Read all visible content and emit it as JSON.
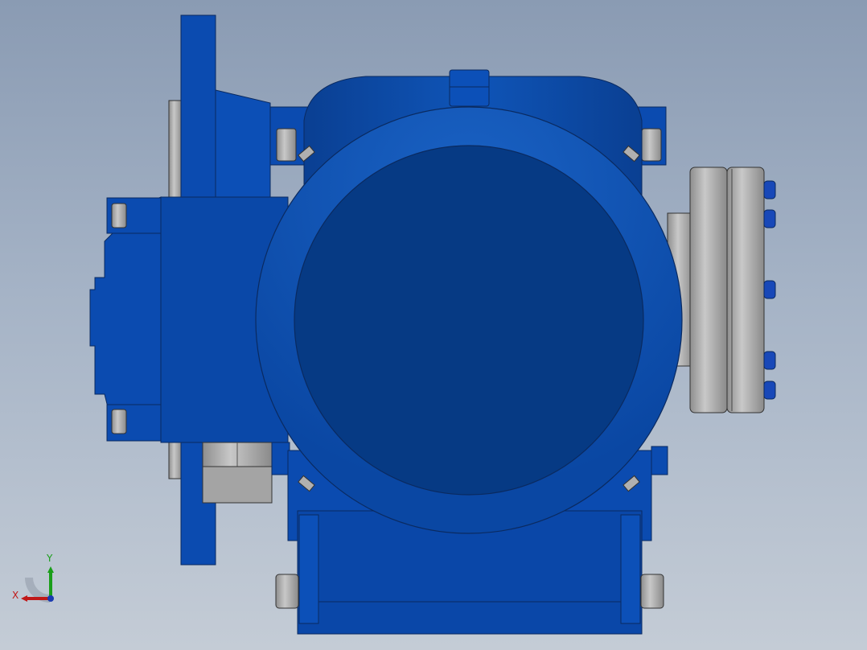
{
  "viewport": {
    "background_top": "#8a9bb3",
    "background_bottom": "#c4ccd6"
  },
  "model": {
    "part_color": "#0a4aa8",
    "part_color_dark": "#063a80",
    "metal_color": "#a8a8a8"
  },
  "triad": {
    "x_label": "X",
    "y_label": "Y",
    "x_color": "#c01818",
    "y_color": "#1a9e1a"
  }
}
